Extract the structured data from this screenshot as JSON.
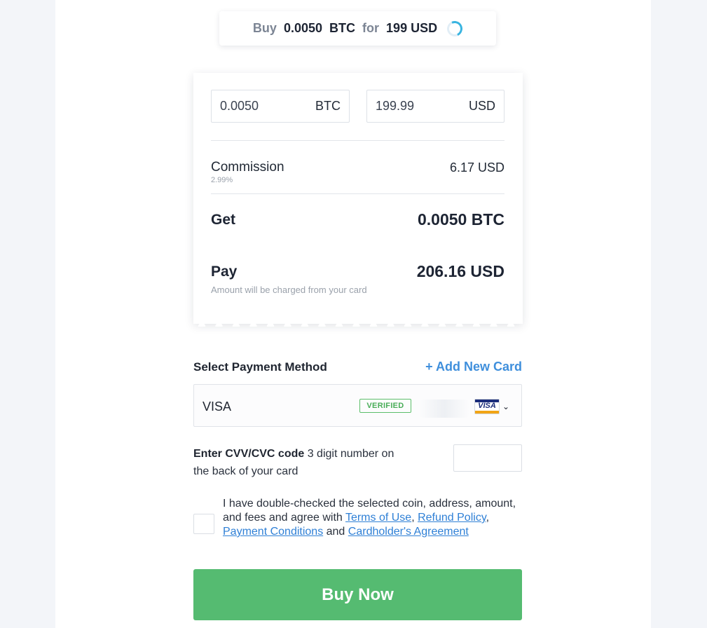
{
  "summary": {
    "buy_word": "Buy",
    "amount": "0.0050",
    "coin": "BTC",
    "for_word": "for",
    "price": "199 USD"
  },
  "calculator": {
    "crypto_value": "0.0050",
    "crypto_unit": "BTC",
    "fiat_value": "199.99",
    "fiat_unit": "USD",
    "commission_label": "Commission",
    "commission_rate": "2.99%",
    "commission_value": "6.17 USD",
    "get_label": "Get",
    "get_value": "0.0050 BTC",
    "pay_label": "Pay",
    "pay_value": "206.16 USD",
    "pay_note": "Amount will be charged from your card"
  },
  "payment": {
    "title": "Select Payment Method",
    "add_card": "+ Add New Card",
    "card_name": "VISA",
    "verified_badge": "VERIFIED",
    "card_brand_logo": "VISA",
    "dropdown_icon": "chevron-down-icon"
  },
  "cvv": {
    "label_bold": "Enter CVV/CVC code",
    "label_rest": " 3 digit number on the back of your card",
    "value": ""
  },
  "agreement": {
    "text_before": "I have double-checked the selected coin, address, amount, and fees and agree with ",
    "terms_link": "Terms of Use",
    "sep1": ", ",
    "refund_link": "Refund Policy",
    "sep2": ", ",
    "conditions_link": "Payment Conditions",
    "and_word": " and ",
    "cardholder_link": "Cardholder's Agreement",
    "checked": false
  },
  "buy_button": "Buy Now",
  "colors": {
    "accent_green": "#55bb71",
    "link_blue": "#2f80d6",
    "verified_green": "#49ad58",
    "spinner_blue": "#39b4e0"
  }
}
